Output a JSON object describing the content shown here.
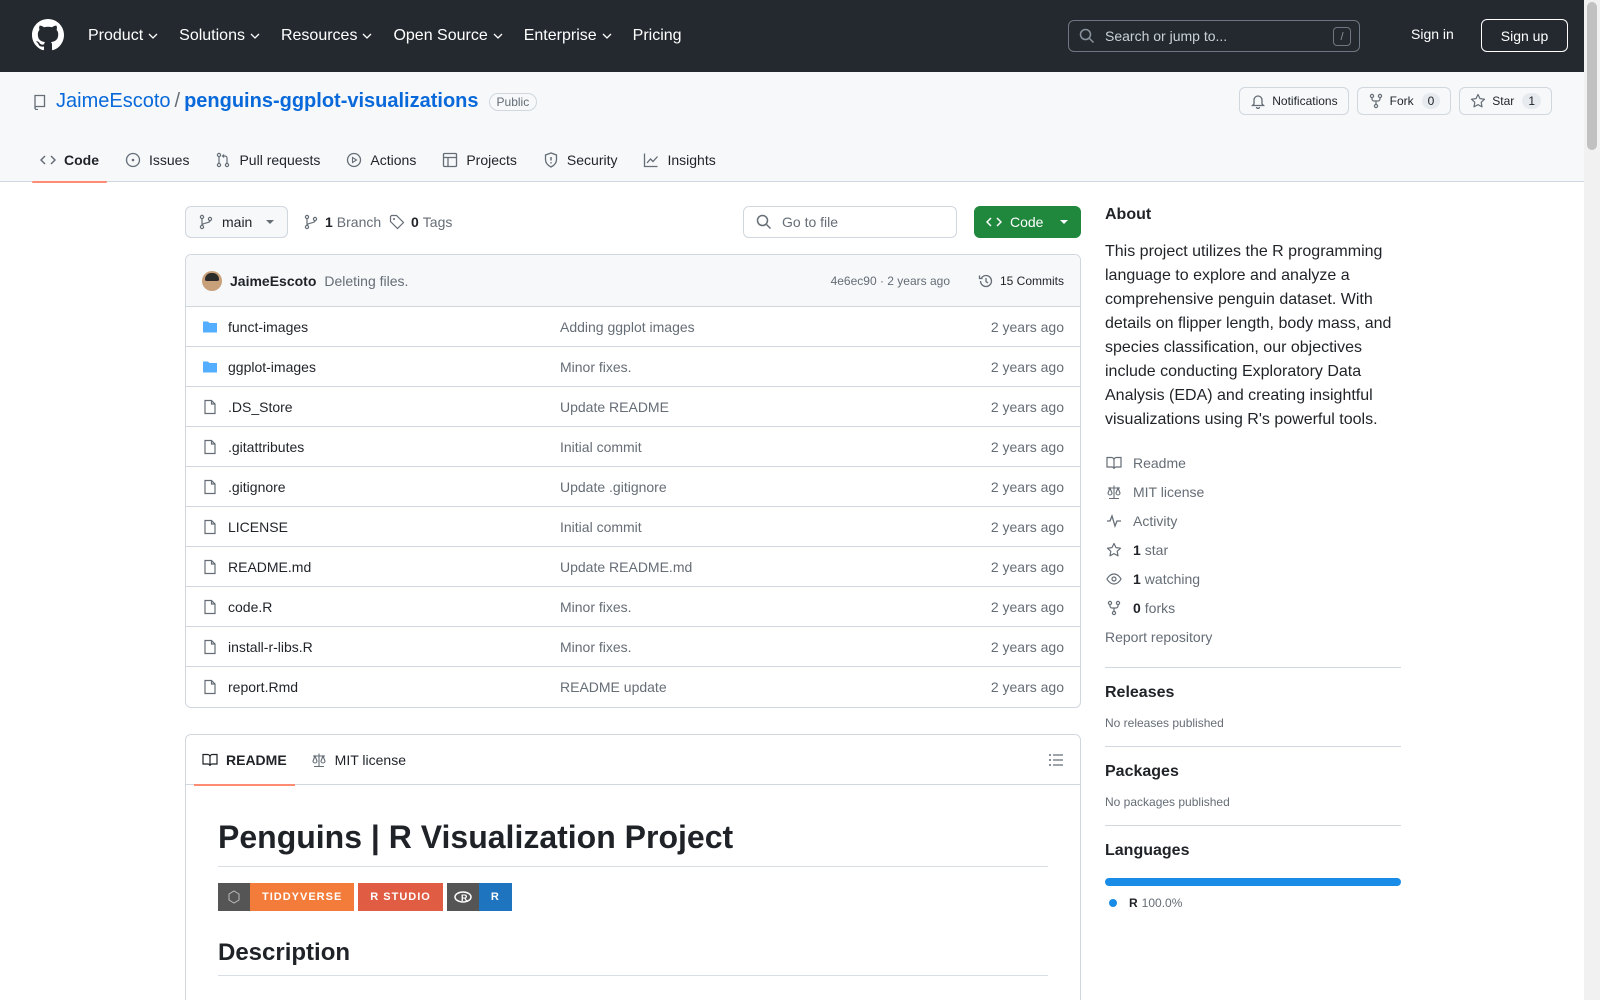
{
  "header": {
    "nav": [
      {
        "label": "Product",
        "dropdown": true
      },
      {
        "label": "Solutions",
        "dropdown": true
      },
      {
        "label": "Resources",
        "dropdown": true
      },
      {
        "label": "Open Source",
        "dropdown": true
      },
      {
        "label": "Enterprise",
        "dropdown": true
      },
      {
        "label": "Pricing",
        "dropdown": false
      }
    ],
    "search_placeholder": "Search or jump to...",
    "search_shortcut": "/",
    "sign_in": "Sign in",
    "sign_up": "Sign up"
  },
  "repo": {
    "owner": "JaimeEscoto",
    "separator": "/",
    "name": "penguins-ggplot-visualizations",
    "visibility": "Public",
    "notifications_label": "Notifications",
    "fork_label": "Fork",
    "fork_count": "0",
    "star_label": "Star",
    "star_count": "1",
    "tabs": [
      {
        "label": "Code",
        "icon": "code-icon",
        "active": true
      },
      {
        "label": "Issues",
        "icon": "issue-icon",
        "active": false
      },
      {
        "label": "Pull requests",
        "icon": "pull-request-icon",
        "active": false
      },
      {
        "label": "Actions",
        "icon": "play-icon",
        "active": false
      },
      {
        "label": "Projects",
        "icon": "table-icon",
        "active": false
      },
      {
        "label": "Security",
        "icon": "shield-icon",
        "active": false
      },
      {
        "label": "Insights",
        "icon": "graph-icon",
        "active": false
      }
    ]
  },
  "filenav": {
    "branch": "main",
    "branch_count": "1",
    "branch_label": "Branch",
    "tag_count": "0",
    "tag_label": "Tags",
    "goto_placeholder": "Go to file",
    "code_button": "Code"
  },
  "commit": {
    "author": "JaimeEscoto",
    "message": "Deleting files.",
    "meta": "4e6ec90 · 2 years ago",
    "commits_label": "15 Commits"
  },
  "files": [
    {
      "type": "dir",
      "name": "funct-images",
      "message": "Adding ggplot images",
      "date": "2 years ago"
    },
    {
      "type": "dir",
      "name": "ggplot-images",
      "message": "Minor fixes.",
      "date": "2 years ago"
    },
    {
      "type": "file",
      "name": ".DS_Store",
      "message": "Update README",
      "date": "2 years ago"
    },
    {
      "type": "file",
      "name": ".gitattributes",
      "message": "Initial commit",
      "date": "2 years ago"
    },
    {
      "type": "file",
      "name": ".gitignore",
      "message": "Update .gitignore",
      "date": "2 years ago"
    },
    {
      "type": "file",
      "name": "LICENSE",
      "message": "Initial commit",
      "date": "2 years ago"
    },
    {
      "type": "file",
      "name": "README.md",
      "message": "Update README.md",
      "date": "2 years ago"
    },
    {
      "type": "file",
      "name": "code.R",
      "message": "Minor fixes.",
      "date": "2 years ago"
    },
    {
      "type": "file",
      "name": "install-r-libs.R",
      "message": "Minor fixes.",
      "date": "2 years ago"
    },
    {
      "type": "file",
      "name": "report.Rmd",
      "message": "README update",
      "date": "2 years ago"
    }
  ],
  "readme": {
    "tab_readme": "README",
    "tab_license": "MIT license",
    "title": "Penguins | R Visualization Project",
    "badges": [
      {
        "label": "TIDDYVERSE",
        "color": "#f37c3a"
      },
      {
        "label": "R STUDIO",
        "color": "#e05d44"
      },
      {
        "label": "R",
        "color": "#1f74c0"
      }
    ],
    "section": "Description"
  },
  "about": {
    "heading": "About",
    "description": "This project utilizes the R programming language to explore and analyze a comprehensive penguin dataset. With details on flipper length, body mass, and species classification, our objectives include conducting Exploratory Data Analysis (EDA) and creating insightful visualizations using R's powerful tools.",
    "readme": "Readme",
    "license": "MIT license",
    "activity": "Activity",
    "stars_count": "1",
    "stars_label": "star",
    "watching_count": "1",
    "watching_label": "watching",
    "forks_count": "0",
    "forks_label": "forks",
    "report": "Report repository"
  },
  "releases": {
    "heading": "Releases",
    "text": "No releases published"
  },
  "packages": {
    "heading": "Packages",
    "text": "No packages published"
  },
  "languages": {
    "heading": "Languages",
    "items": [
      {
        "name": "R",
        "percent": "100.0%",
        "color": "#198CE7"
      }
    ]
  }
}
